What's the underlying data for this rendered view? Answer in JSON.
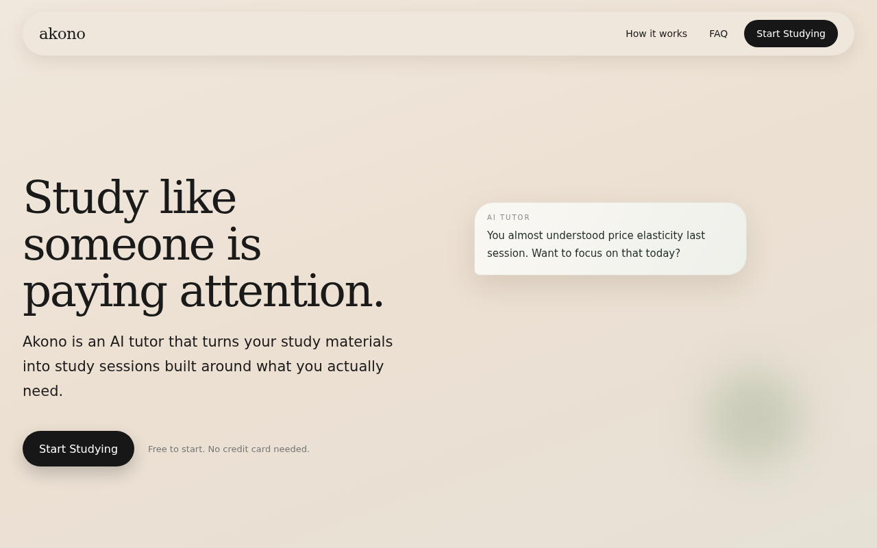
{
  "nav": {
    "logo": "akono",
    "links": [
      "How it works",
      "FAQ"
    ],
    "cta": "Start Studying"
  },
  "hero": {
    "heading": "Study like someone is paying attention.",
    "description": "Akono is an AI tutor that turns your study materials into study sessions built around what you actually need.",
    "cta": "Start Studying",
    "note": "Free to start. No credit card needed."
  },
  "tutor_card": {
    "label": "AI TUTOR",
    "message": "You almost understood price elasticity last session. Want to focus on that today?"
  }
}
